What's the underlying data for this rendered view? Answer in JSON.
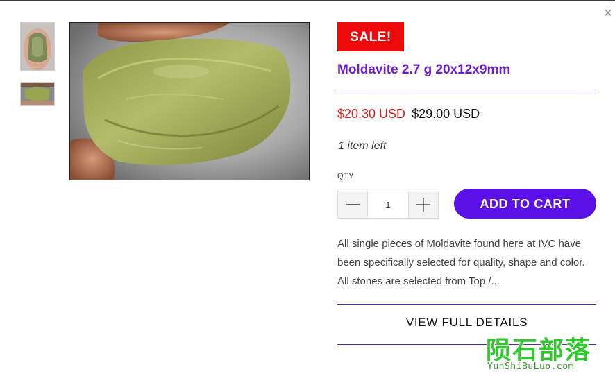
{
  "modal": {
    "close_icon": "×"
  },
  "gallery": {
    "thumbnails": [
      "moldavite-thumb-vertical",
      "moldavite-thumb-horizontal"
    ],
    "main_image": "moldavite-held-between-fingers"
  },
  "product": {
    "badge": "SALE!",
    "title": "Moldavite 2.7 g 20x12x9mm",
    "sale_price": "$20.30 USD",
    "original_price": "$29.00 USD",
    "stock": "1 item left",
    "qty_label": "QTY",
    "qty_value": "1",
    "add_to_cart": "ADD TO CART",
    "description": "All single pieces of Moldavite found here at IVC have been specifically selected for quality, shape and color. All stones are selected from Top /...",
    "details_link": "VIEW FULL DETAILS"
  },
  "watermark": {
    "text": "陨石部落",
    "url": "YunShiBuLuo.com"
  },
  "colors": {
    "badge": "#ee0a0a",
    "title": "#6a1ccf",
    "sale_price": "#e11b1b",
    "button": "#5a10e6",
    "divider": "#5b2ab5",
    "watermark": "#31c82f"
  },
  "icons": {
    "decrement": "minus-icon",
    "increment": "plus-icon",
    "close": "close-icon"
  }
}
